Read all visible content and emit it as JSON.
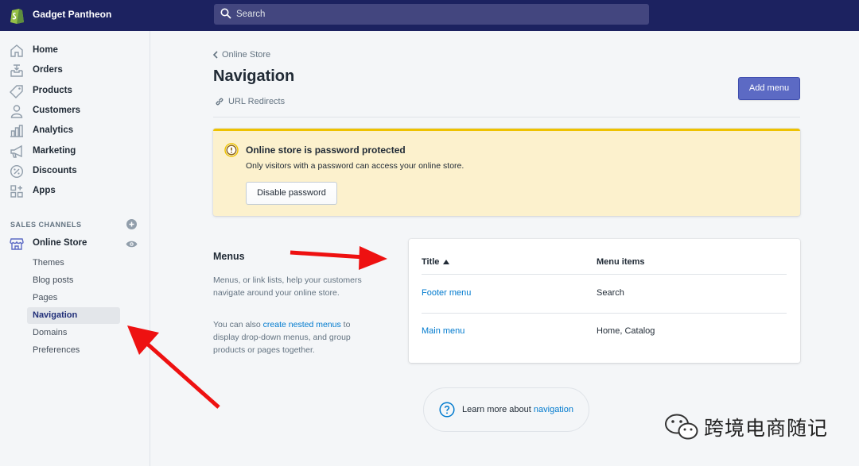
{
  "topbar": {
    "store_name": "Gadget Pantheon",
    "search_placeholder": "Search"
  },
  "sidebar": {
    "items": [
      {
        "label": "Home",
        "icon": "home-icon"
      },
      {
        "label": "Orders",
        "icon": "orders-icon"
      },
      {
        "label": "Products",
        "icon": "tag-icon"
      },
      {
        "label": "Customers",
        "icon": "person-icon"
      },
      {
        "label": "Analytics",
        "icon": "bar-chart-icon"
      },
      {
        "label": "Marketing",
        "icon": "megaphone-icon"
      },
      {
        "label": "Discounts",
        "icon": "discount-icon"
      },
      {
        "label": "Apps",
        "icon": "apps-icon"
      }
    ],
    "sales_channels_title": "SALES CHANNELS",
    "online_store": "Online Store",
    "sub_items": [
      "Themes",
      "Blog posts",
      "Pages",
      "Navigation",
      "Domains",
      "Preferences"
    ],
    "active_sub_item": "Navigation"
  },
  "main": {
    "breadcrumb": "Online Store",
    "title": "Navigation",
    "url_redirects": "URL Redirects",
    "add_menu_label": "Add menu",
    "banner": {
      "title": "Online store is password protected",
      "text": "Only visitors with a password can access your online store.",
      "button": "Disable password"
    },
    "menus_section": {
      "title": "Menus",
      "description": "Menus, or link lists, help your customers navigate around your online store.",
      "description2_prefix": "You can also ",
      "description2_link": "create nested menus",
      "description2_suffix": " to display drop-down menus, and group products or pages together."
    },
    "table": {
      "headers": [
        "Title",
        "Menu items"
      ],
      "rows": [
        {
          "title": "Footer menu",
          "items": "Search"
        },
        {
          "title": "Main menu",
          "items": "Home, Catalog"
        }
      ]
    },
    "learn_more": {
      "prefix": "Learn more about ",
      "link": "navigation"
    }
  },
  "watermark": {
    "text": "跨境电商随记"
  },
  "colors": {
    "topbar": "#1c2260",
    "primary_button": "#5c6ac4",
    "banner_bg": "#fcf1cd",
    "banner_border": "#eec200",
    "link": "#007ace",
    "annotation_arrow": "#ee1111"
  }
}
